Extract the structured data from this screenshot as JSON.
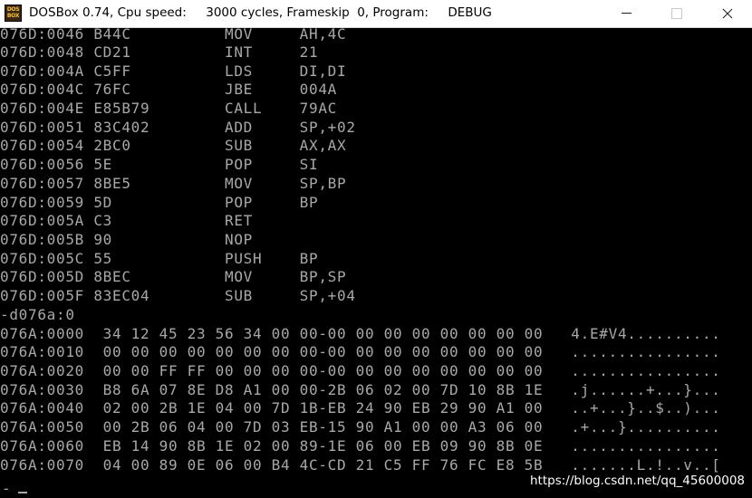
{
  "window": {
    "icon_text_top": "DOS",
    "icon_text_bottom": "BOX",
    "title": "DOSBox 0.74, Cpu speed:     3000 cycles, Frameskip  0, Program:     DEBUG"
  },
  "console": {
    "lines": [
      "076D:0046 B44C          MOV     AH,4C",
      "076D:0048 CD21          INT     21",
      "076D:004A C5FF          LDS     DI,DI",
      "076D:004C 76FC          JBE     004A",
      "076D:004E E85B79        CALL    79AC",
      "076D:0051 83C402        ADD     SP,+02",
      "076D:0054 2BC0          SUB     AX,AX",
      "076D:0056 5E            POP     SI",
      "076D:0057 8BE5          MOV     SP,BP",
      "076D:0059 5D            POP     BP",
      "076D:005A C3            RET",
      "076D:005B 90            NOP",
      "076D:005C 55            PUSH    BP",
      "076D:005D 8BEC          MOV     BP,SP",
      "076D:005F 83EC04        SUB     SP,+04",
      "-d076a:0",
      "076A:0000  34 12 45 23 56 34 00 00-00 00 00 00 00 00 00 00   4.E#V4..........",
      "076A:0010  00 00 00 00 00 00 00 00-00 00 00 00 00 00 00 00   ................",
      "076A:0020  00 00 FF FF 00 00 00 00-00 00 00 00 00 00 00 00   ................",
      "076A:0030  B8 6A 07 8E D8 A1 00 00-2B 06 02 00 7D 10 8B 1E   .j......+...}...",
      "076A:0040  02 00 2B 1E 04 00 7D 1B-EB 24 90 EB 29 90 A1 00   ..+...}..$..)...",
      "076A:0050  00 2B 06 04 00 7D 03 EB-15 90 A1 00 00 A3 06 00   .+...}..........",
      "076A:0060  EB 14 90 8B 1E 02 00 89-1E 06 00 EB 09 90 8B 0E   ................",
      "076A:0070  04 00 89 0E 06 00 B4 4C-CD 21 C5 FF 76 FC E8 5B   .......L.!..v..["
    ],
    "prompt": "-"
  },
  "watermark": "https://blog.csdn.net/qq_45600008",
  "colors": {
    "terminal_text": "#a8a8a8",
    "terminal_bg": "#000000",
    "titlebar_bg": "#ffffff"
  }
}
